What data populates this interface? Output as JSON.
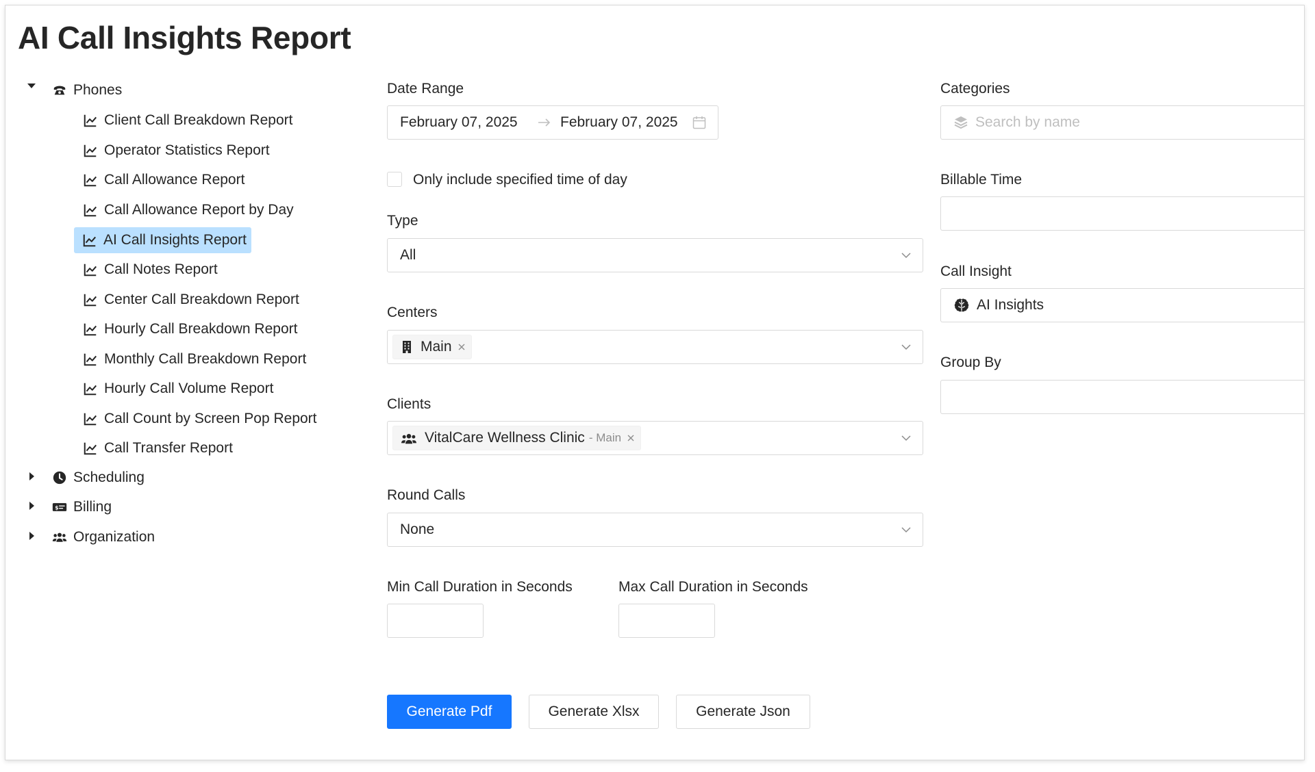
{
  "page": {
    "title": "AI Call Insights Report"
  },
  "tree": {
    "phones": {
      "label": "Phones",
      "icon": "phone-icon",
      "expanded": true,
      "items": [
        {
          "label": "Client Call Breakdown Report"
        },
        {
          "label": "Operator Statistics Report"
        },
        {
          "label": "Call Allowance Report"
        },
        {
          "label": "Call Allowance Report by Day"
        },
        {
          "label": "AI Call Insights Report",
          "selected": true
        },
        {
          "label": "Call Notes Report"
        },
        {
          "label": "Center Call Breakdown Report"
        },
        {
          "label": "Hourly Call Breakdown Report"
        },
        {
          "label": "Monthly Call Breakdown Report"
        },
        {
          "label": "Hourly Call Volume Report"
        },
        {
          "label": "Call Count by Screen Pop Report"
        },
        {
          "label": "Call Transfer Report"
        }
      ]
    },
    "scheduling": {
      "label": "Scheduling",
      "icon": "clock-icon",
      "expanded": false
    },
    "billing": {
      "label": "Billing",
      "icon": "money-check-icon",
      "expanded": false
    },
    "organization": {
      "label": "Organization",
      "icon": "users-icon",
      "expanded": false
    }
  },
  "form": {
    "date_range": {
      "label": "Date Range",
      "start": "February 07, 2025",
      "end": "February 07, 2025"
    },
    "time_of_day": {
      "label": "Only include specified time of day",
      "checked": false
    },
    "type": {
      "label": "Type",
      "value": "All"
    },
    "centers": {
      "label": "Centers",
      "tags": [
        {
          "label": "Main",
          "icon": "building-icon"
        }
      ]
    },
    "clients": {
      "label": "Clients",
      "tags": [
        {
          "label": "VitalCare Wellness Clinic",
          "suffix": "- Main",
          "icon": "users-icon"
        }
      ]
    },
    "round_calls": {
      "label": "Round Calls",
      "value": "None"
    },
    "min_duration": {
      "label": "Min Call Duration in Seconds",
      "value": ""
    },
    "max_duration": {
      "label": "Max Call Duration in Seconds",
      "value": ""
    },
    "categories": {
      "label": "Categories",
      "placeholder": "Search by name"
    },
    "billable_time": {
      "label": "Billable Time",
      "value": ""
    },
    "call_insight": {
      "label": "Call Insight",
      "value": "AI Insights",
      "icon": "brain-icon"
    },
    "group_by": {
      "label": "Group By",
      "value": ""
    }
  },
  "actions": {
    "generate_pdf": "Generate Pdf",
    "generate_xlsx": "Generate Xlsx",
    "generate_json": "Generate Json"
  },
  "colors": {
    "primary": "#1677ff",
    "selected_bg": "#bae0ff",
    "border": "#d9d9d9",
    "placeholder": "#bfbfbf"
  }
}
